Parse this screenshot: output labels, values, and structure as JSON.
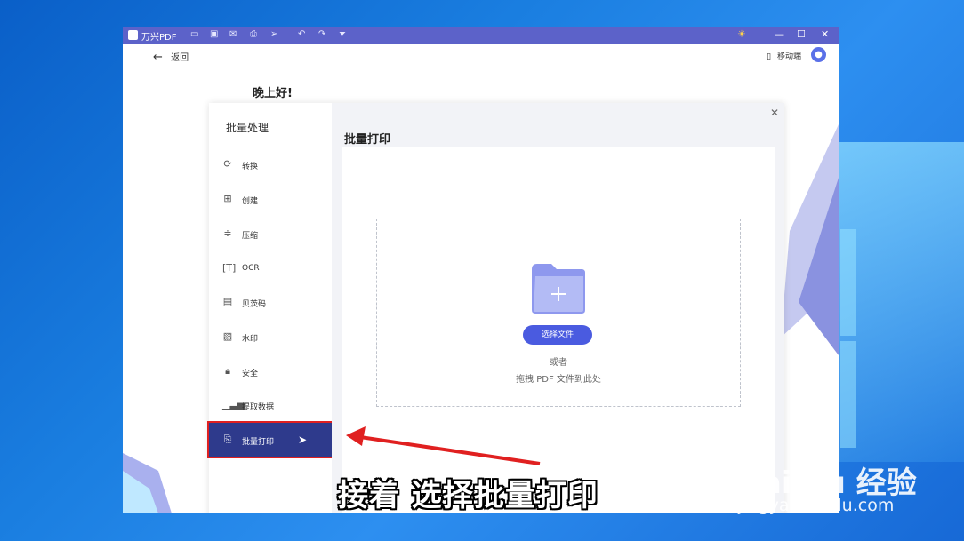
{
  "app": {
    "name": "万兴PDF",
    "back_label": "返回",
    "mobile_label": "移动端",
    "greeting": "晚上好!"
  },
  "dialog": {
    "sidebar_title": "批量处理",
    "items": [
      {
        "label": "转换",
        "icon": "refresh-icon"
      },
      {
        "label": "创建",
        "icon": "create-doc-icon"
      },
      {
        "label": "压缩",
        "icon": "compress-icon"
      },
      {
        "label": "OCR",
        "icon": "ocr-icon"
      },
      {
        "label": "贝茨码",
        "icon": "bates-icon"
      },
      {
        "label": "水印",
        "icon": "watermark-icon"
      },
      {
        "label": "安全",
        "icon": "lock-icon"
      },
      {
        "label": "提取数据",
        "icon": "bar-chart-icon"
      },
      {
        "label": "批量打印",
        "icon": "print-doc-icon"
      }
    ],
    "active_item": "批量打印",
    "main_title": "批量打印",
    "choose_button": "选择文件",
    "or_text": "或者",
    "drag_text": "拖拽 PDF 文件到此处"
  },
  "overlay": {
    "subtitle": "接着 选择批量打印",
    "watermark_top": "Bai du 经验",
    "watermark_bottom": "jingyan.baidu.com"
  },
  "colors": {
    "titlebar": "#5c62c9",
    "active_item": "#2e3a8c",
    "button": "#4a5be0",
    "highlight": "#e02020"
  }
}
